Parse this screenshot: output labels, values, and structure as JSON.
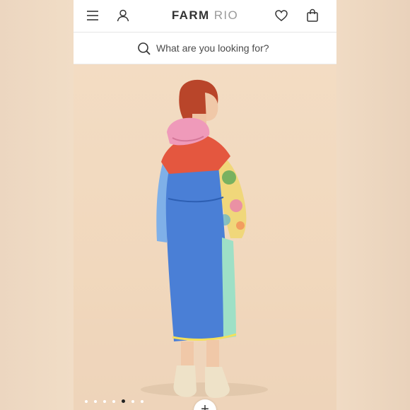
{
  "header": {
    "brand_primary": "FARM",
    "brand_secondary": "RIO",
    "icons": {
      "menu": "menu-icon",
      "account": "user-icon",
      "wishlist": "heart-icon",
      "cart": "bag-icon"
    }
  },
  "search": {
    "placeholder": "What are you looking for?",
    "icon": "search-icon"
  },
  "gallery": {
    "total_images": 7,
    "active_index": 5,
    "zoom_button_label": "+"
  },
  "colors": {
    "background": "#f2d9be",
    "coat_blue": "#4a7fd6",
    "coat_red": "#e4573f",
    "hood_pink": "#ef9aba"
  }
}
